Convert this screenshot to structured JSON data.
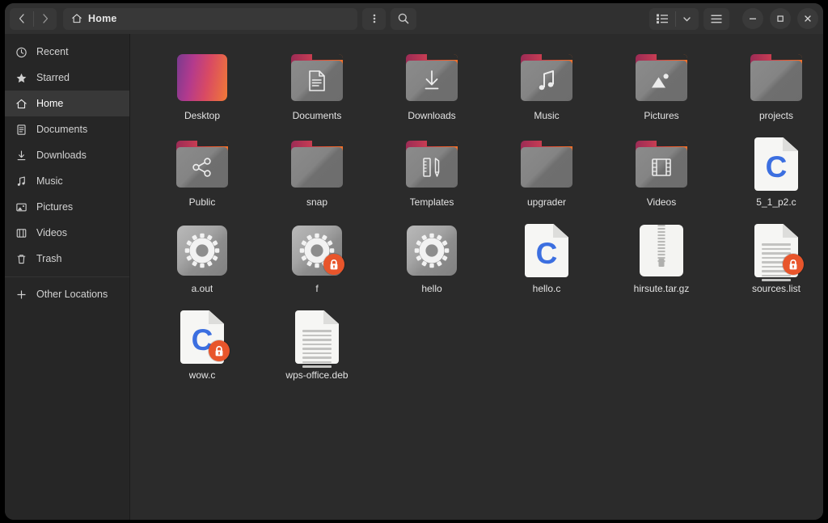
{
  "window": {
    "title": "Home",
    "bg_color": "#2b2b2b",
    "header_color": "#303030",
    "sidebar_color": "#262626",
    "accent_color": "#e8552b"
  },
  "header": {
    "back_label": "Back",
    "forward_label": "Forward",
    "path_label": "Home",
    "path_icon": "home-icon",
    "options_label": "View Options",
    "search_label": "Search",
    "list_view_label": "List View",
    "view_dropdown_label": "View Menu",
    "main_menu_label": "Main Menu",
    "minimize_label": "Minimize",
    "maximize_label": "Maximize",
    "close_label": "Close"
  },
  "sidebar": {
    "items": [
      {
        "label": "Recent",
        "icon": "clock-icon",
        "selected": false
      },
      {
        "label": "Starred",
        "icon": "star-icon",
        "selected": false
      },
      {
        "label": "Home",
        "icon": "home-icon",
        "selected": true
      },
      {
        "label": "Documents",
        "icon": "document-icon",
        "selected": false
      },
      {
        "label": "Downloads",
        "icon": "download-icon",
        "selected": false
      },
      {
        "label": "Music",
        "icon": "music-icon",
        "selected": false
      },
      {
        "label": "Pictures",
        "icon": "picture-icon",
        "selected": false
      },
      {
        "label": "Videos",
        "icon": "video-icon",
        "selected": false
      },
      {
        "label": "Trash",
        "icon": "trash-icon",
        "selected": false
      }
    ],
    "other_locations": {
      "label": "Other Locations",
      "icon": "plus-icon"
    }
  },
  "files": [
    {
      "name": "Desktop",
      "type": "desktop-image",
      "glyph": "none",
      "locked": false
    },
    {
      "name": "Documents",
      "type": "folder",
      "glyph": "document",
      "locked": false
    },
    {
      "name": "Downloads",
      "type": "folder",
      "glyph": "download",
      "locked": false
    },
    {
      "name": "Music",
      "type": "folder",
      "glyph": "music",
      "locked": false
    },
    {
      "name": "Pictures",
      "type": "folder",
      "glyph": "picture",
      "locked": false
    },
    {
      "name": "projects",
      "type": "folder",
      "glyph": "none",
      "locked": false
    },
    {
      "name": "Public",
      "type": "folder",
      "glyph": "share",
      "locked": false
    },
    {
      "name": "snap",
      "type": "folder",
      "glyph": "none",
      "locked": false
    },
    {
      "name": "Templates",
      "type": "folder",
      "glyph": "template",
      "locked": false
    },
    {
      "name": "upgrader",
      "type": "folder",
      "glyph": "none",
      "locked": false
    },
    {
      "name": "Videos",
      "type": "folder",
      "glyph": "video",
      "locked": false
    },
    {
      "name": "5_1_p2.c",
      "type": "code-file",
      "glyph": "C",
      "locked": false
    },
    {
      "name": "a.out",
      "type": "executable",
      "glyph": "gear",
      "locked": false
    },
    {
      "name": "f",
      "type": "executable",
      "glyph": "gear",
      "locked": true
    },
    {
      "name": "hello",
      "type": "executable",
      "glyph": "gear",
      "locked": false
    },
    {
      "name": "hello.c",
      "type": "code-file",
      "glyph": "C",
      "locked": false
    },
    {
      "name": "hirsute.tar.gz",
      "type": "archive",
      "glyph": "zip",
      "locked": false
    },
    {
      "name": "sources.list",
      "type": "text-file",
      "glyph": "lines",
      "locked": true
    },
    {
      "name": "wow.c",
      "type": "code-file",
      "glyph": "C",
      "locked": true
    },
    {
      "name": "wps-office.deb",
      "type": "text-file",
      "glyph": "lines",
      "locked": false
    }
  ]
}
